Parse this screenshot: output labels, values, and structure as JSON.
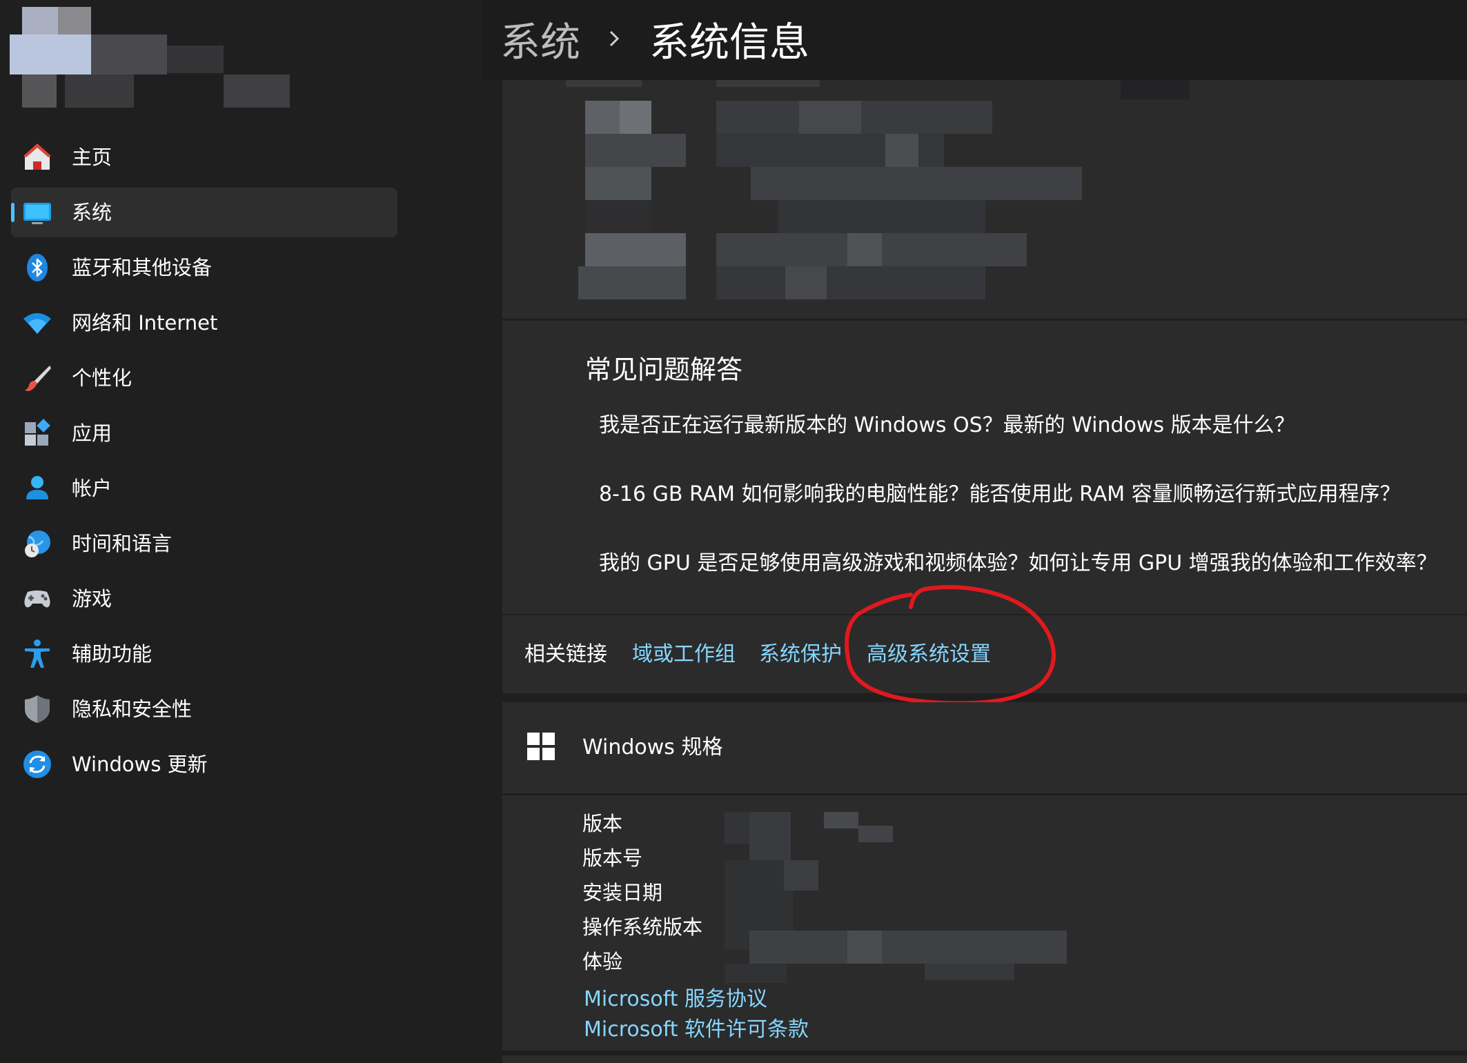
{
  "breadcrumb": {
    "parent": "系统",
    "current": "系统信息"
  },
  "sidebar": {
    "items": [
      {
        "label": "主页"
      },
      {
        "label": "系统"
      },
      {
        "label": "蓝牙和其他设备"
      },
      {
        "label": "网络和 Internet"
      },
      {
        "label": "个性化"
      },
      {
        "label": "应用"
      },
      {
        "label": "帐户"
      },
      {
        "label": "时间和语言"
      },
      {
        "label": "游戏"
      },
      {
        "label": "辅助功能"
      },
      {
        "label": "隐私和安全性"
      },
      {
        "label": "Windows 更新"
      }
    ],
    "selected": "系统"
  },
  "faq": {
    "title": "常见问题解答",
    "items": [
      "我是否正在运行最新版本的 Windows OS？最新的 Windows 版本是什么？",
      "8-16 GB RAM 如何影响我的电脑性能？能否使用此 RAM 容量顺畅运行新式应用程序？",
      "我的 GPU 是否足够使用高级游戏和视频体验？如何让专用 GPU 增强我的体验和工作效率？"
    ]
  },
  "related_links": {
    "label": "相关链接",
    "links": [
      "域或工作组",
      "系统保护",
      "高级系统设置"
    ]
  },
  "windows_spec": {
    "title": "Windows 规格",
    "rows": [
      "版本",
      "版本号",
      "安装日期",
      "操作系统版本",
      "体验"
    ],
    "links": [
      "Microsoft 服务协议",
      "Microsoft 软件许可条款"
    ]
  },
  "colors": {
    "link": "#86d6ff",
    "accent": "#4cc2ff",
    "annotation": "#e0191e",
    "card": "#2b2b2b",
    "background": "#1f1f1f"
  }
}
